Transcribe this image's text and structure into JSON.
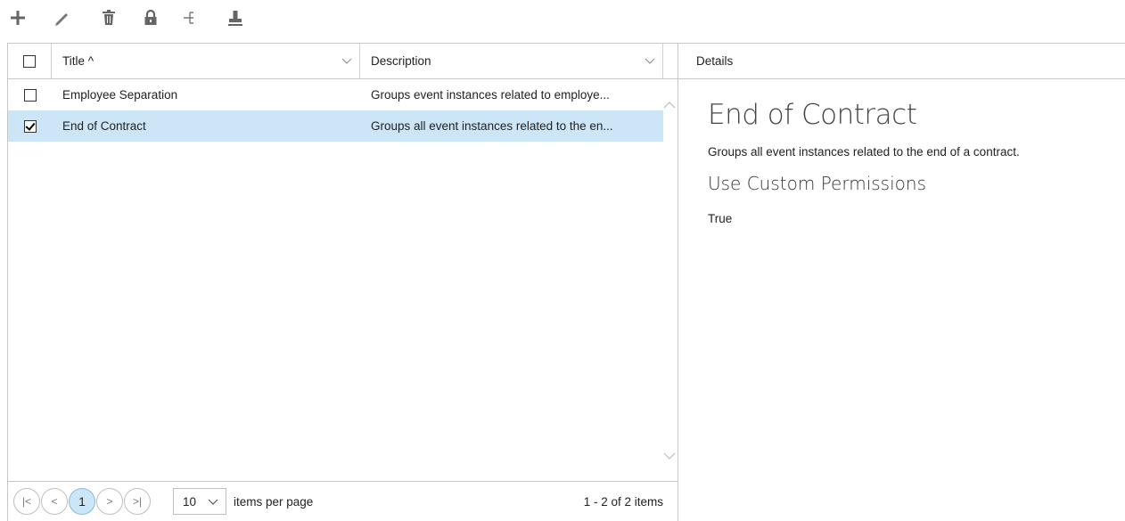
{
  "toolbar": {
    "items": [
      {
        "icon": "plus-icon"
      },
      {
        "icon": "pencil-icon"
      },
      {
        "icon": "trash-icon"
      },
      {
        "icon": "lock-icon"
      },
      {
        "icon": "hierarchy-icon"
      },
      {
        "icon": "stamp-icon"
      }
    ]
  },
  "grid": {
    "columns": {
      "title": "Title ^",
      "description": "Description"
    },
    "rows": [
      {
        "title": "Employee Separation",
        "description": "Groups event instances related to employe...",
        "checked": false,
        "selected": false
      },
      {
        "title": "End of Contract",
        "description": "Groups all event instances related to the en...",
        "checked": true,
        "selected": true
      }
    ],
    "pager": {
      "first": "|<",
      "prev": "<",
      "page": "1",
      "next": ">",
      "last": ">|",
      "page_size": "10",
      "page_size_label": "items per page",
      "info": "1 - 2 of 2 items"
    }
  },
  "details": {
    "header": "Details",
    "title": "End of Contract",
    "description": "Groups all event instances related to the end of a contract.",
    "subheading": "Use Custom Permissions",
    "value": "True"
  },
  "colors": {
    "selected_row": "#cde6f7",
    "border": "#c6c6c6",
    "icon": "#6b6b6b"
  }
}
